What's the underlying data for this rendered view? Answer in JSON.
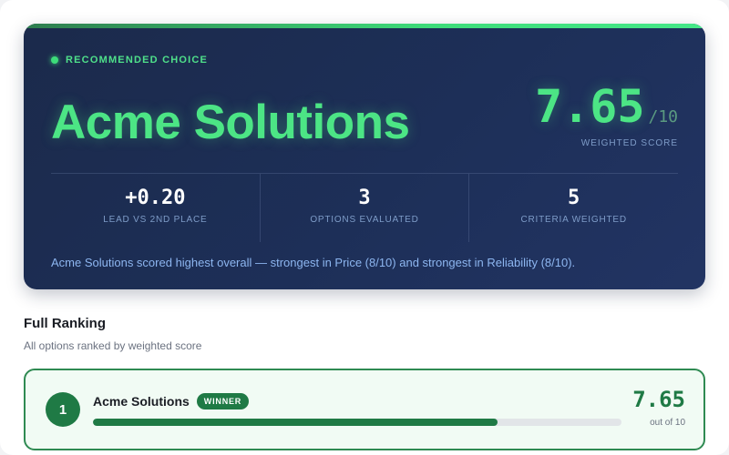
{
  "hero": {
    "badge": "RECOMMENDED CHOICE",
    "winner_name": "Acme Solutions",
    "score": "7.65",
    "score_denominator": "/10",
    "score_label": "WEIGHTED SCORE",
    "stats": [
      {
        "value": "+0.20",
        "label": "LEAD VS 2ND PLACE"
      },
      {
        "value": "3",
        "label": "OPTIONS EVALUATED"
      },
      {
        "value": "5",
        "label": "CRITERIA WEIGHTED"
      }
    ],
    "summary": "Acme Solutions scored highest overall — strongest in Price (8/10) and strongest in Reliability (8/10)."
  },
  "ranking": {
    "title": "Full Ranking",
    "subtitle": "All options ranked by weighted score",
    "items": [
      {
        "rank": "1",
        "name": "Acme Solutions",
        "badge": "WINNER",
        "score": "7.65",
        "score_sub": "out of 10",
        "bar_fraction": 0.765
      }
    ]
  },
  "colors": {
    "accent_green": "#4ce585",
    "winner_green": "#1f7a45",
    "hero_bg": "#1d2f58"
  },
  "icons": {
    "status_dot": "status-dot-icon"
  }
}
